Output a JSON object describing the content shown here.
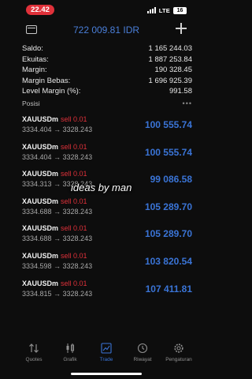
{
  "status": {
    "time": "22.42",
    "network": "LTE",
    "battery": "16"
  },
  "header": {
    "balance": "722 009.81 IDR",
    "wallet_icon": "wallet-icon",
    "add_icon": "plus-icon"
  },
  "summary": [
    {
      "label": "Saldo:",
      "value": "1 165 244.03"
    },
    {
      "label": "Ekuitas:",
      "value": "1 887 253.84"
    },
    {
      "label": "Margin:",
      "value": "190 328.45"
    },
    {
      "label": "Margin Bebas:",
      "value": "1 696 925.39"
    },
    {
      "label": "Level Margin (%):",
      "value": "991.58"
    }
  ],
  "positions": {
    "title": "Posisi",
    "more": "•••",
    "items": [
      {
        "symbol": "XAUUSDm",
        "side": "sell 0.01",
        "prices": "3334.404 → 3328.243",
        "profit": "100 555.74"
      },
      {
        "symbol": "XAUUSDm",
        "side": "sell 0.01",
        "prices": "3334.404 → 3328.243",
        "profit": "100 555.74"
      },
      {
        "symbol": "XAUUSDm",
        "side": "sell 0.01",
        "prices": "3334.313 → 3328.243",
        "profit": "99 086.58"
      },
      {
        "symbol": "XAUUSDm",
        "side": "sell 0.01",
        "prices": "3334.688 → 3328.243",
        "profit": "105 289.70"
      },
      {
        "symbol": "XAUUSDm",
        "side": "sell 0.01",
        "prices": "3334.688 → 3328.243",
        "profit": "105 289.70"
      },
      {
        "symbol": "XAUUSDm",
        "side": "sell 0.01",
        "prices": "3334.598 → 3328.243",
        "profit": "103 820.54"
      },
      {
        "symbol": "XAUUSDm",
        "side": "sell 0.01",
        "prices": "3334.815 → 3328.243",
        "profit": "107 411.81"
      }
    ]
  },
  "watermark": "ideas by man",
  "tabs": [
    {
      "label": "Quotes",
      "icon": "arrows-updown-icon",
      "active": false
    },
    {
      "label": "Grafik",
      "icon": "candlestick-icon",
      "active": false
    },
    {
      "label": "Trade",
      "icon": "trade-chart-icon",
      "active": true
    },
    {
      "label": "Riwayat",
      "icon": "history-icon",
      "active": false
    },
    {
      "label": "Pengaturan",
      "icon": "gear-icon",
      "active": false
    }
  ],
  "colors": {
    "accent": "#3a74d6",
    "sell": "#e0313a",
    "background": "#0d0d0d"
  }
}
